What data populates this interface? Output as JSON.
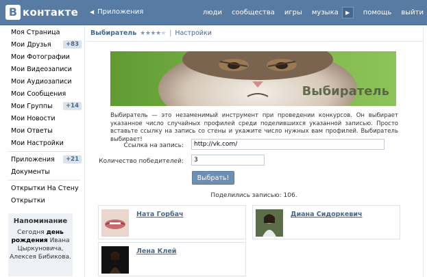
{
  "header": {
    "logo_letter": "В",
    "logo_text": "контакте",
    "back_label": "Приложения",
    "nav": [
      "люди",
      "сообщества",
      "игры",
      "музыка",
      "помощь",
      "выйти"
    ]
  },
  "sidebar": {
    "items": [
      {
        "label": "Моя Страница",
        "badge": ""
      },
      {
        "label": "Мои Друзья",
        "badge": "+83"
      },
      {
        "label": "Мои Фотографии",
        "badge": ""
      },
      {
        "label": "Мои Видеозаписи",
        "badge": ""
      },
      {
        "label": "Мои Аудиозаписи",
        "badge": ""
      },
      {
        "label": "Мои Сообщения",
        "badge": ""
      },
      {
        "label": "Мои Группы",
        "badge": "+14"
      },
      {
        "label": "Мои Новости",
        "badge": ""
      },
      {
        "label": "Мои Ответы",
        "badge": ""
      },
      {
        "label": "Мои Настройки",
        "badge": ""
      },
      {
        "label": "Приложения",
        "badge": "+21"
      },
      {
        "label": "Документы",
        "badge": ""
      },
      {
        "label": "Открытки На Стену",
        "badge": ""
      },
      {
        "label": "Открытки",
        "badge": ""
      }
    ],
    "reminder": {
      "title": "Напоминание",
      "text_before": "Сегодня ",
      "text_bold": "день рождения",
      "text_after": " Ивана Цыркуновича, Алексея Бибикова."
    }
  },
  "main": {
    "app_name": "Выбиратель",
    "rating": 4,
    "rating_max": 5,
    "settings_label": "Настройки",
    "banner_title": "Выбиратель",
    "description": "Выбиратель — это незаменимый инструмент при проведении конкурсов. Он выбирает указанное число случайных профилей среди поделившихся указанной записью. Просто вставьте ссылку на запись со стены и укажите число нужных вам профилей. Выбиратель выбирает!",
    "link_label": "Ссылка на запись:",
    "link_value": "http://vk.com/",
    "winners_label": "Количество победителей:",
    "winners_value": "3",
    "submit_label": "Выбрать!",
    "shared_text": "Поделились записью: 106.",
    "winners": [
      {
        "name": "Ната Горбач"
      },
      {
        "name": "Диана Сидоркевич"
      },
      {
        "name": "Лена Клей"
      }
    ]
  },
  "colors": {
    "header_bg": "#587ba3",
    "link": "#45688e",
    "button": "#6d8fb3",
    "badge_bg": "#dae2ea",
    "reminder_bg": "#eef2f6"
  }
}
